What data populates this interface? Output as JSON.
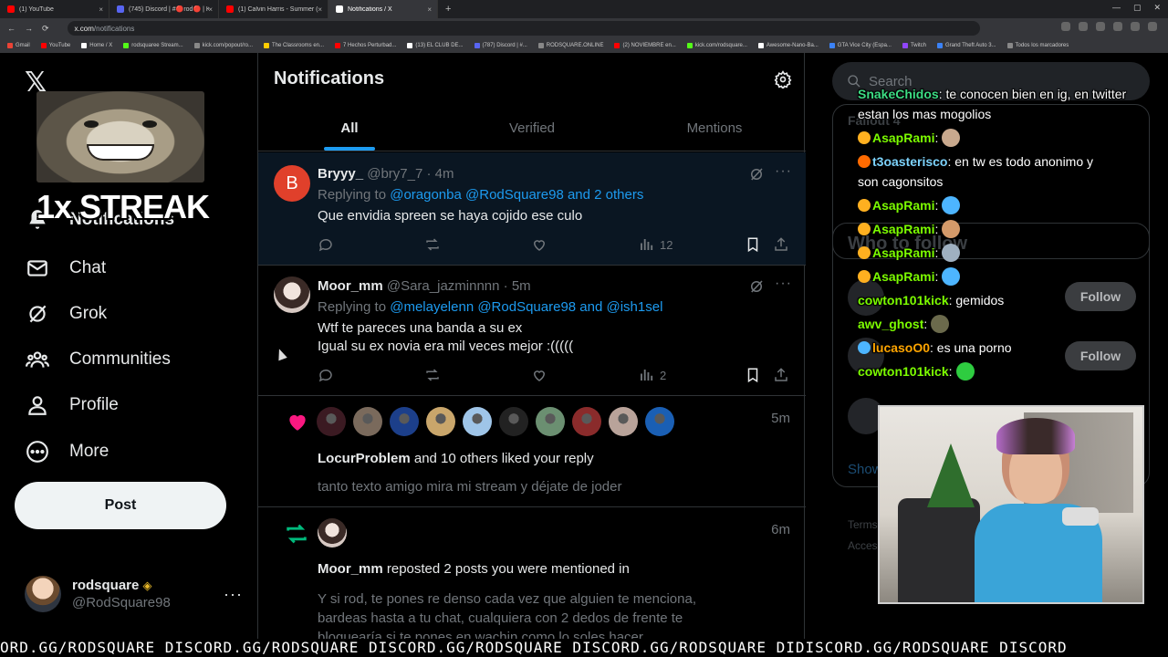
{
  "browser": {
    "tabs": [
      {
        "label": "(1) YouTube",
        "active": false,
        "color": "#ff0000"
      },
      {
        "label": "(745) Discord | #🔴rod🔴 | KICK",
        "active": false,
        "color": "#5865f2"
      },
      {
        "label": "(1) Calvin Harris - Summer (Offic",
        "active": false,
        "color": "#ff0000"
      },
      {
        "label": "Notifications / X",
        "active": true,
        "color": "#ffffff"
      }
    ],
    "new_tab": "+",
    "url_host": "x.com",
    "url_path": "/notifications",
    "bookmarks": [
      {
        "label": "Gmail",
        "color": "#ea4335"
      },
      {
        "label": "YouTube",
        "color": "#ff0000"
      },
      {
        "label": "Home / X",
        "color": "#ffffff"
      },
      {
        "label": "rodsquaree Stream...",
        "color": "#53fc18"
      },
      {
        "label": "kick.com/popout/ro...",
        "color": "#888888"
      },
      {
        "label": "The Classrooms en...",
        "color": "#ffcc00"
      },
      {
        "label": "7 Hechos Perturbad...",
        "color": "#ff0000"
      },
      {
        "label": "(13) EL CLUB DE...",
        "color": "#ffffff"
      },
      {
        "label": "(787) Discord | #...",
        "color": "#5865f2"
      },
      {
        "label": "RODSQUARE.ONLINE",
        "color": "#888888"
      },
      {
        "label": "(2) NOVIEMBRE en...",
        "color": "#ff0000"
      },
      {
        "label": "kick.com/rodsquare...",
        "color": "#53fc18"
      },
      {
        "label": "Awesome-Nano-Ba...",
        "color": "#ffffff"
      },
      {
        "label": "GTA Vice City (Espa...",
        "color": "#3b82f6"
      },
      {
        "label": "Twitch",
        "color": "#9146ff"
      },
      {
        "label": "Grand Theft Auto 3...",
        "color": "#3b82f6"
      },
      {
        "label": "Todos los marcadores",
        "color": "#888888"
      }
    ]
  },
  "sidebar": {
    "logo": "𝕏",
    "items": [
      {
        "label": "Notifications",
        "icon": "bell-icon"
      },
      {
        "label": "Chat",
        "icon": "mail-icon"
      },
      {
        "label": "Grok",
        "icon": "grok-icon"
      },
      {
        "label": "Communities",
        "icon": "communities-icon"
      },
      {
        "label": "Profile",
        "icon": "person-icon"
      },
      {
        "label": "More",
        "icon": "more-circle-icon"
      }
    ],
    "post_button": "Post",
    "account": {
      "name": "rodsquare",
      "handle": "@RodSquare98",
      "more": "···"
    }
  },
  "overlay": {
    "streak": "1x STREAK"
  },
  "main": {
    "title": "Notifications",
    "tabs": [
      {
        "label": "All",
        "active": true
      },
      {
        "label": "Verified",
        "active": false
      },
      {
        "label": "Mentions",
        "active": false
      }
    ],
    "tweets": [
      {
        "avatar_letter": "B",
        "avatar_color": "#e0402b",
        "name": "Bryyy_",
        "handle": "@bry7_7 · 4m",
        "reply_prefix": "Replying to ",
        "reply_mentions": "@oragonba @RodSquare98 and 2 others",
        "lines": [
          "Que envidia spreen se haya cojido ese culo"
        ],
        "views": "12"
      },
      {
        "avatar_letter": "",
        "avatar_color": "#d7c9c3",
        "name": "Moor_mm",
        "handle": "@Sara_jazminnnn · 5m",
        "reply_prefix": "Replying to ",
        "reply_mentions": "@melayelenn @RodSquare98 and @ish1sel",
        "lines": [
          "Wtf te pareces una banda a su ex",
          "Igual su ex novia era mil veces mejor :((((("
        ],
        "views": "2"
      }
    ],
    "like_notification": {
      "time": "5m",
      "user": "LocurProblem",
      "text": " and 10 others liked your reply",
      "quote": "tanto texto amigo mira mi stream y déjate de joder",
      "avatar_colors": [
        "#3b1a22",
        "#7a6a5c",
        "#1c3f8a",
        "#c9a66b",
        "#9fc5e8",
        "#222222",
        "#6b8f71",
        "#8a2b2b",
        "#b9a39a",
        "#1a5fb4"
      ]
    },
    "repost_notification": {
      "time": "6m",
      "user": "Moor_mm",
      "text": " reposted 2 posts you were mentioned in",
      "quote_lines": [
        "Y si rod, te pones re denso cada vez que alguien te menciona,",
        "bardeas hasta a tu chat, cualquiera con 2 dedos de frente te",
        "bloquearía si te pones en wachin como lo soles hacer"
      ]
    }
  },
  "right": {
    "search_placeholder": "Search",
    "faint_labels": [
      "Fallout 4",
      "Who to follow",
      "Show",
      "Terms",
      "Acces"
    ],
    "follow_label": "Follow",
    "ghost_names": [
      "Follow",
      "@hefftonsha"
    ]
  },
  "chat": [
    {
      "user": "SnakeChidos",
      "color": "#3ddc84",
      "badge": "",
      "text": ": te conocen bien en ig, en twitter",
      "text2": "estan los mas mogolios"
    },
    {
      "user": "AsapRami",
      "color": "#7cfc00",
      "badge": "#ffb020",
      "text": ":",
      "emote": "#c9a98e"
    },
    {
      "user": "t3oasterisco",
      "color": "#7dd3fc",
      "badge": "#ff6a00",
      "text": ": en tw es todo anonimo y",
      "text2": "son cagonsitos"
    },
    {
      "user": "AsapRami",
      "color": "#7cfc00",
      "badge": "#ffb020",
      "text": ":",
      "emote": "#4db5ff"
    },
    {
      "user": "AsapRami",
      "color": "#7cfc00",
      "badge": "#ffb020",
      "text": ":",
      "emote": "#d49a6a"
    },
    {
      "user": "AsapRami",
      "color": "#7cfc00",
      "badge": "#ffb020",
      "text": ":",
      "emote": "#9fb0c0"
    },
    {
      "user": "AsapRami",
      "color": "#7cfc00",
      "badge": "#ffb020",
      "text": ":",
      "emote": "#4db5ff"
    },
    {
      "user": "cowton101kick",
      "color": "#7cfc00",
      "badge": "",
      "text": ": gemidos"
    },
    {
      "user": "awv_ghost",
      "color": "#7cfc00",
      "badge": "",
      "text": ":",
      "emote": "#6b6a4c"
    },
    {
      "user": "lucasoO0",
      "color": "#ffa500",
      "badge": "#4db5ff",
      "text": ": es una porno"
    },
    {
      "user": "cowton101kick",
      "color": "#7cfc00",
      "badge": "",
      "text": ":",
      "emote": "#2ecc40"
    }
  ],
  "ticker": "ORD.GG/RODSQUARE DISCORD.GG/RODSQUARE DISCORD.GG/RODSQUARE DISCORD.GG/RODSQUARE DIDISCORD.GG/RODSQUARE DISCORD"
}
